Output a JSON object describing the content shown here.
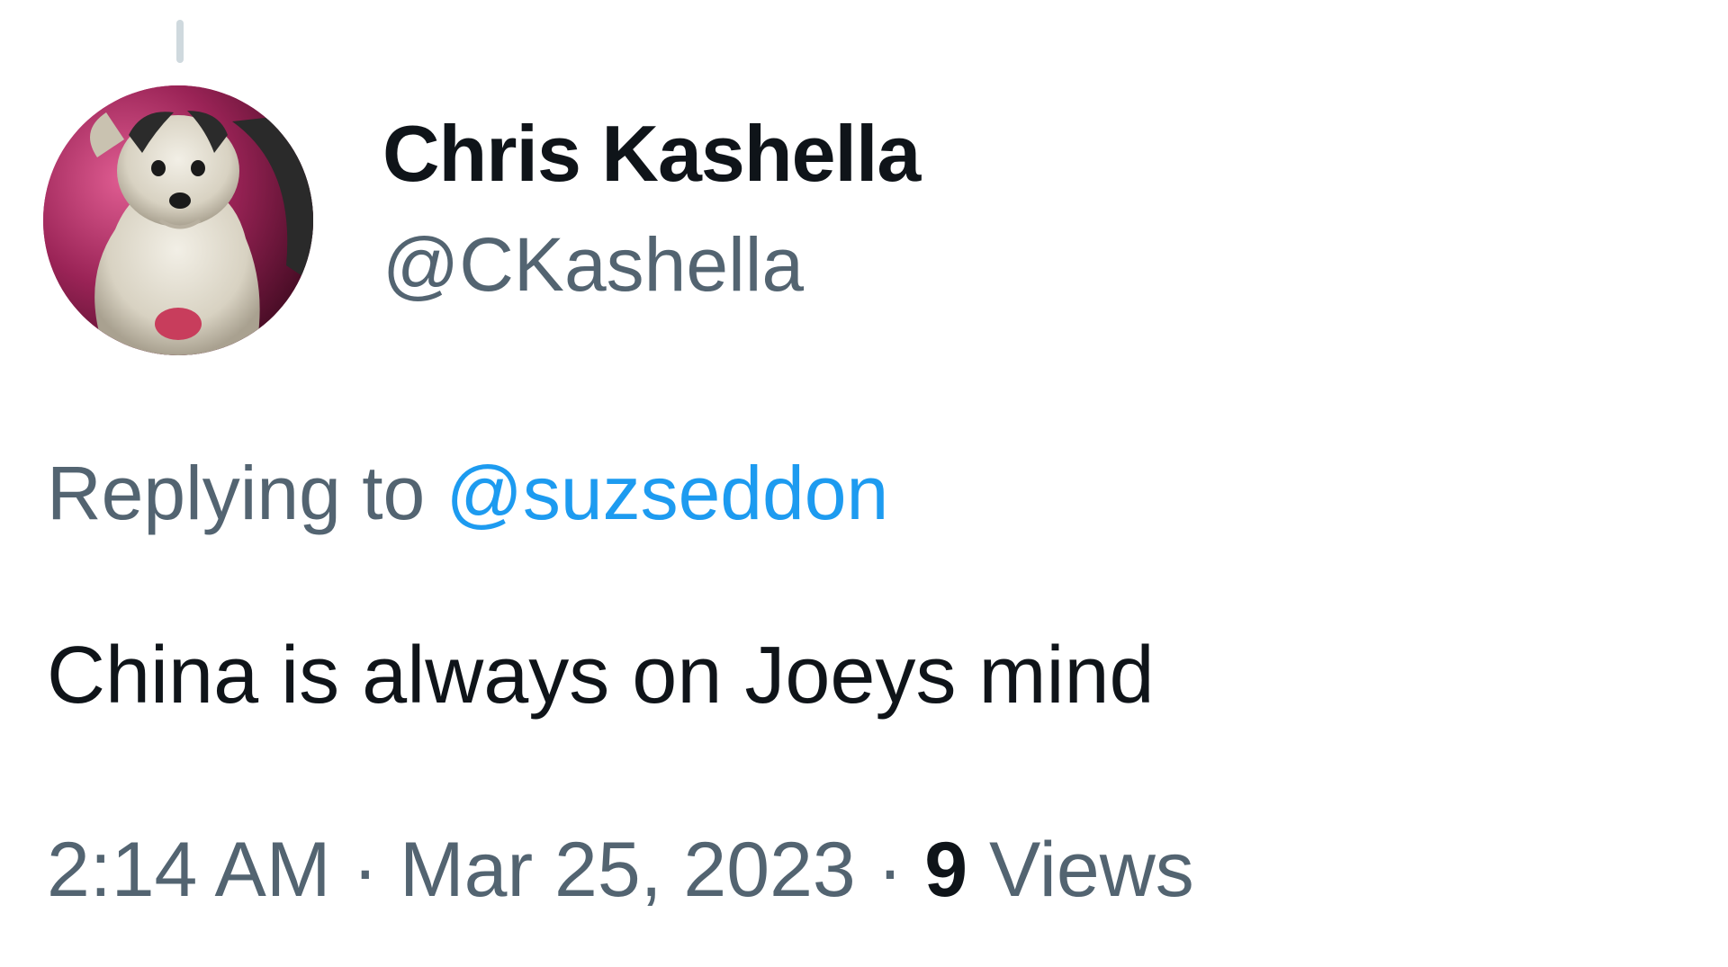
{
  "tweet": {
    "author": {
      "display_name": "Chris Kashella",
      "handle": "@CKashella",
      "avatar_icon": "dog-avatar-icon"
    },
    "reply_context": {
      "prefix": "Replying to",
      "mention": "@suzseddon"
    },
    "text": "China is always on Joeys mind",
    "meta": {
      "time": "2:14 AM",
      "separator": "·",
      "date": "Mar 25, 2023",
      "views_count": "9",
      "views_label": "Views"
    }
  },
  "colors": {
    "primary_text": "#0f1419",
    "secondary_text": "#536471",
    "link": "#1d9bf0",
    "thread_line": "#cfd9de"
  }
}
